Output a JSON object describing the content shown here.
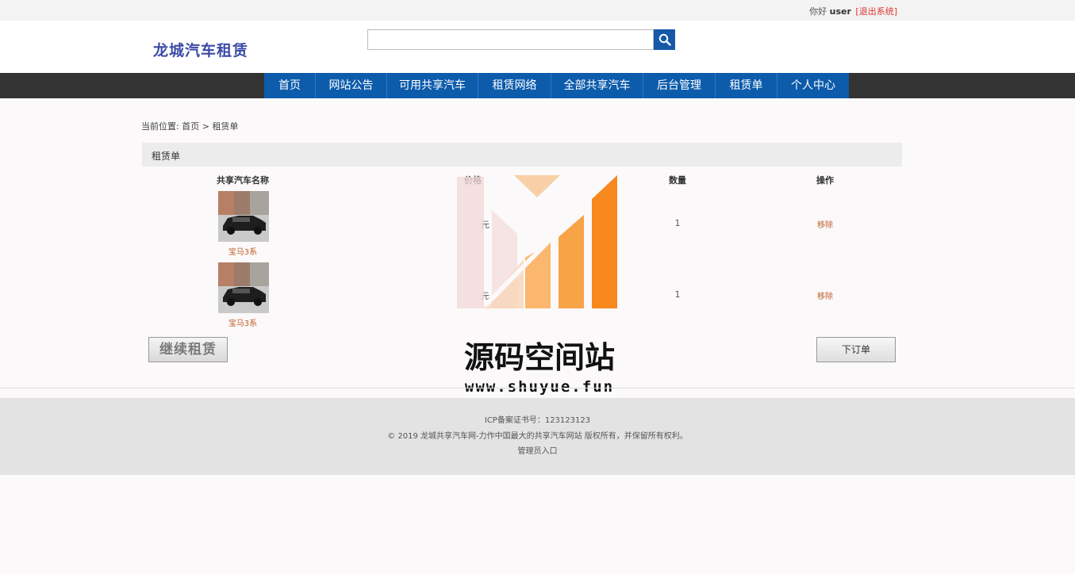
{
  "topbar": {
    "greeting": "你好",
    "username": "user",
    "logout": "[退出系统]"
  },
  "header": {
    "logo": "龙城汽车租赁",
    "search": {
      "value": "",
      "placeholder": ""
    }
  },
  "nav": {
    "items": [
      "首页",
      "网站公告",
      "可用共享汽车",
      "租赁网络",
      "全部共享汽车",
      "后台管理",
      "租赁单",
      "个人中心"
    ]
  },
  "breadcrumb": {
    "prefix": "当前位置:",
    "home": "首页",
    "separator": ">",
    "current": "租赁单"
  },
  "panel": {
    "title": "租赁单"
  },
  "table": {
    "headers": [
      "共享汽车名称",
      "价格",
      "数量",
      "操作"
    ],
    "rows": [
      {
        "name": "宝马3系",
        "price": "元",
        "qty": "1",
        "action": "移除"
      },
      {
        "name": "宝马3系",
        "price": "元",
        "qty": "1",
        "action": "移除"
      }
    ]
  },
  "buttons": {
    "continue": "继续租赁",
    "order": "下订单"
  },
  "footer": {
    "icp": "ICP备案证书号：123123123",
    "copyright": "© 2019 龙城共享汽车网-力作中国最大的共享汽车网站 版权所有，并保留所有权利。",
    "admin": "管理员入口"
  },
  "watermark": {
    "title": "源码空间站",
    "url": "www.shuyue.fun"
  },
  "colors": {
    "nav": "#0d5cac",
    "navbar": "#333333",
    "link": "#c0602a",
    "accent": "#f7891f"
  }
}
